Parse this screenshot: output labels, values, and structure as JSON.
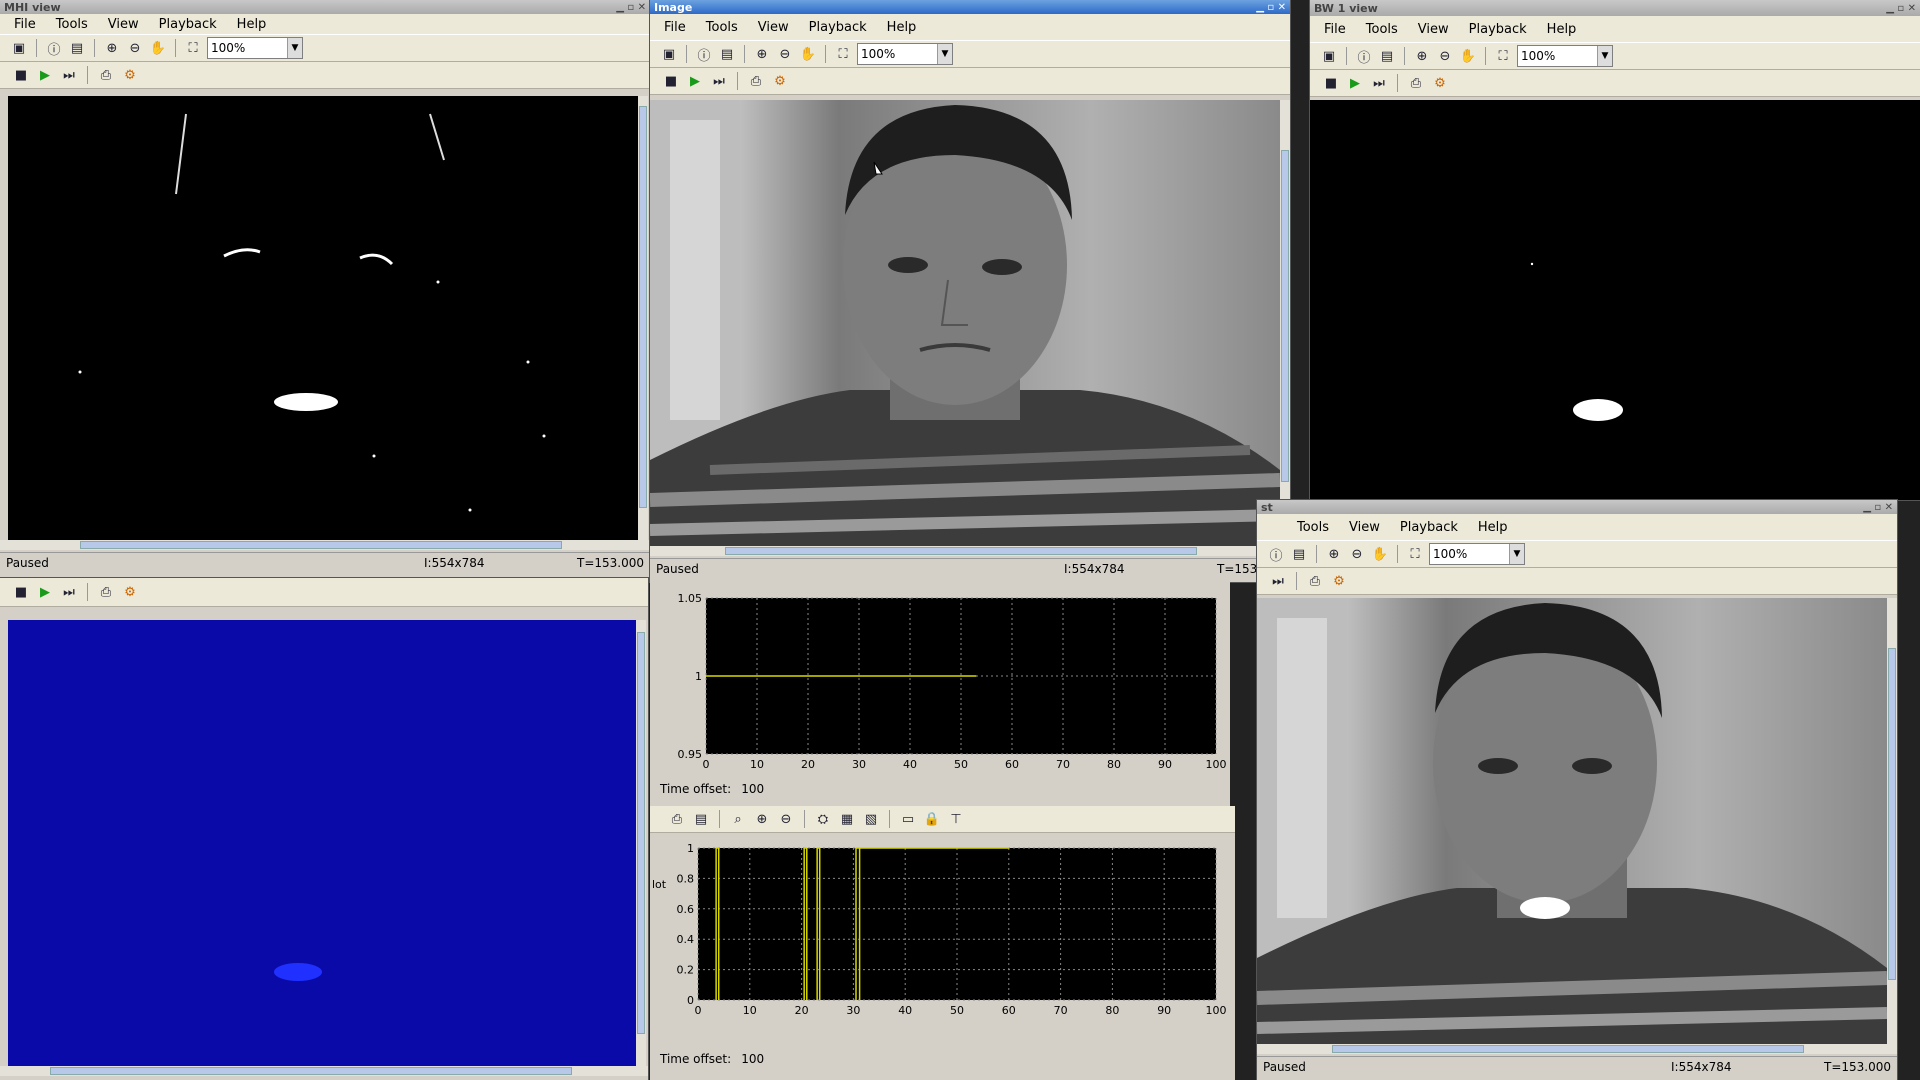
{
  "menu": [
    "File",
    "Tools",
    "View",
    "Playback",
    "Help"
  ],
  "zoom_value": "100%",
  "status": {
    "state": "Paused",
    "dims": "I:554x784",
    "time": "T=153.000"
  },
  "windows": {
    "mhi": {
      "title": "MHI view"
    },
    "image": {
      "title": "Image"
    },
    "bw": {
      "title": "BW 1 view"
    },
    "st": {
      "title": "st"
    }
  },
  "scope1": {
    "time_offset_label": "Time offset:",
    "time_offset": "100"
  },
  "scope2": {
    "time_offset_label": "Time offset:",
    "time_offset": "100",
    "side_label": "lot"
  },
  "colors": {
    "blue_view": "#0a0aa8",
    "signal": "#d8d800"
  },
  "chart_data": [
    {
      "type": "line",
      "xlim": [
        0,
        100
      ],
      "ylim": [
        0.95,
        1.05
      ],
      "xticks": [
        "0",
        "10",
        "20",
        "30",
        "40",
        "50",
        "60",
        "70",
        "80",
        "90",
        "100"
      ],
      "yticks": [
        "0.95",
        "1",
        "1.05"
      ],
      "x": [
        0,
        53
      ],
      "y": [
        1,
        1
      ],
      "grid": true
    },
    {
      "type": "line",
      "xlim": [
        0,
        100
      ],
      "ylim": [
        0,
        1
      ],
      "xticks": [
        "0",
        "10",
        "20",
        "30",
        "40",
        "50",
        "60",
        "70",
        "80",
        "90",
        "100"
      ],
      "yticks": [
        "0",
        "0.2",
        "0.4",
        "0.6",
        "0.8",
        "1"
      ],
      "pulses": [
        [
          3.5,
          4
        ],
        [
          20.5,
          21
        ],
        [
          23,
          23.5
        ],
        [
          30.5,
          31.2
        ]
      ],
      "high_segments": [
        [
          31.2,
          60
        ]
      ],
      "grid": true
    }
  ]
}
